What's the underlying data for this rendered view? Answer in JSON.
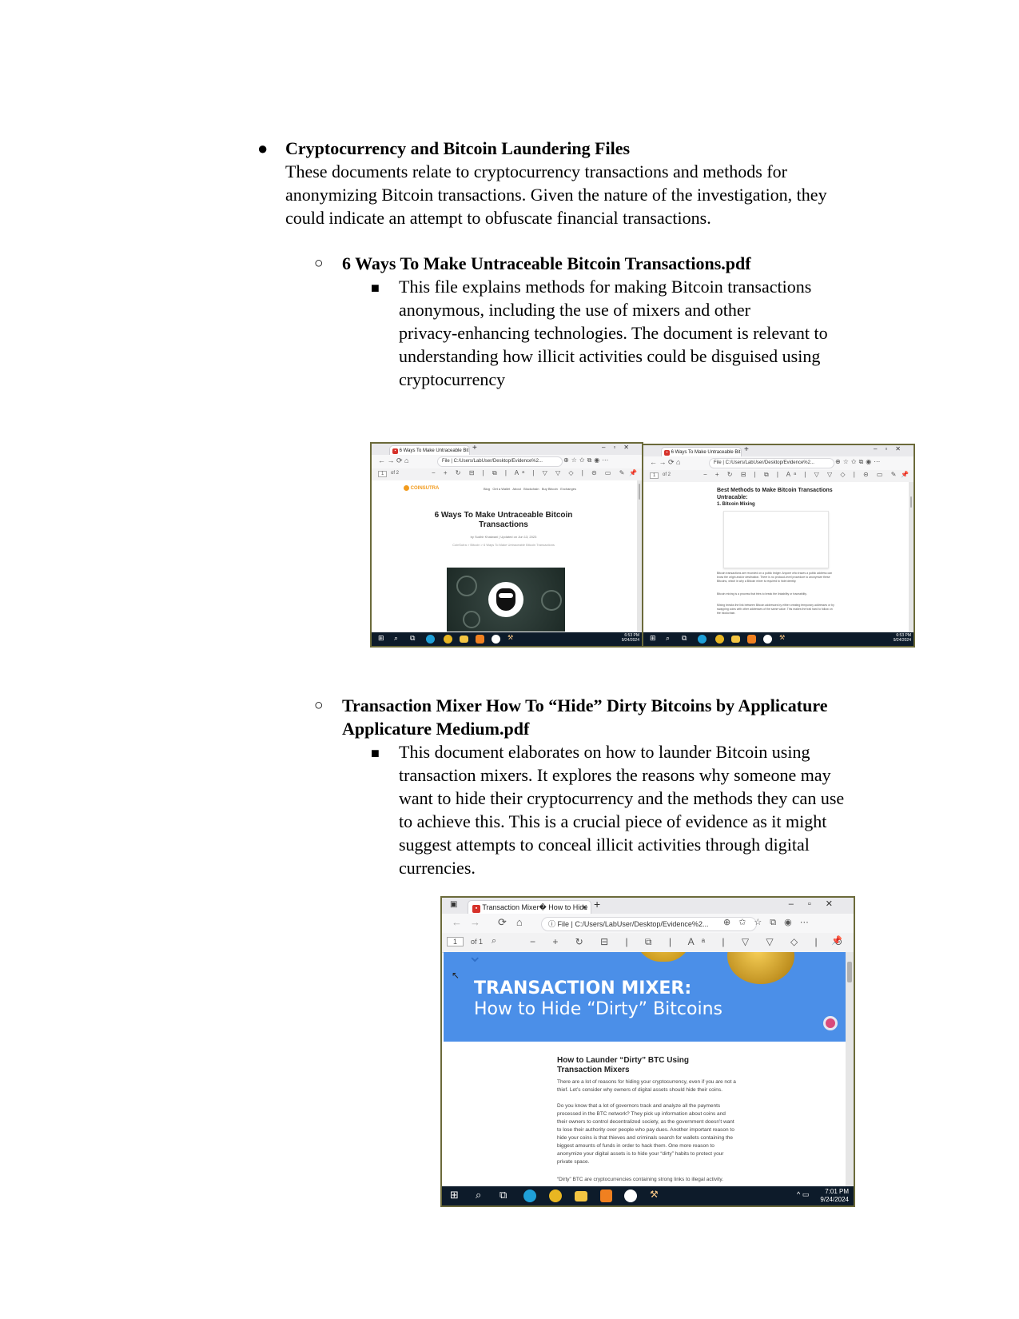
{
  "section": {
    "title": "Cryptocurrency and Bitcoin Laundering Files",
    "intro": [
      "These documents relate to cryptocurrency transactions and methods for",
      "anonymizing Bitcoin transactions. Given the nature of the investigation, they",
      "could indicate an attempt to obfuscate financial transactions."
    ],
    "bullet_glyph": "●",
    "sub_glyph": "○",
    "square_glyph": "■"
  },
  "file1": {
    "title": "6 Ways To Make Untraceable Bitcoin Transactions.pdf",
    "desc": [
      "This file explains methods for making Bitcoin transactions",
      "anonymous, including the use of mixers and other",
      "privacy-enhancing technologies. The document is relevant to",
      "understanding how illicit activities could be disguised using",
      "cryptocurrency"
    ]
  },
  "file2": {
    "title_lines": [
      "Transaction Mixer How To “Hide” Dirty Bitcoins by Applicature",
      "Applicature Medium.pdf"
    ],
    "desc": [
      "This document elaborates on how to launder Bitcoin using",
      "transaction mixers. It explores the reasons why someone may",
      "want to hide their cryptocurrency and the methods they can use",
      "to achieve this. This is a crucial piece of evidence as it might",
      "suggest attempts to conceal illicit activities through digital",
      "currencies."
    ]
  },
  "shot1": {
    "tab": "6 Ways To Make Untraceable Bit",
    "address": "C:/Users/LabUser/Desktop/Evidence%2...",
    "file_label": "File",
    "page_num": "1",
    "page_of": "of 2",
    "site_logo": "COINSUTRA",
    "site_nav": [
      "Blog",
      "Get a Wallet",
      "About",
      "Blockchain",
      "Buy Bitcoin",
      "Exchanges"
    ],
    "heading": "6 Ways To Make Untraceable Bitcoin Transactions",
    "byline": "by Sudhir Khatwani  |  Updated on Jun 13, 2023",
    "breadcrumb": "CoinSutra > Bitcoin > 6 Ways To Make Untraceable Bitcoin Transactions",
    "time": "6:53 PM",
    "date": "9/24/2024"
  },
  "shot2": {
    "tab": "6 Ways To Make Untraceable Bit",
    "address": "C:/Users/LabUser/Desktop/Evidence%2...",
    "file_label": "File",
    "page_num": "1",
    "page_of": "of 2",
    "heading": "Best Methods to Make Bitcoin Transactions Untracable:",
    "subheading": "1. Bitcoin Mixing",
    "para1": "Bitcoin transactions are recorded on a public ledger. Anyone who traces a public address can know the origin and/or destination. There is no protocol-level procedure to anonymize these Bitcoins, which is why a Bitcoin mixer is required to hide identity.",
    "para2": "Bitcoin mixing is a process that tries to break the linkability or traceability.",
    "para3": "Mixing breaks the link between Bitcoin addresses by either creating temporary addresses or by swapping coins with other addresses of the same value. This makes the trail hard to follow on the blockchain.",
    "time": "6:53 PM",
    "date": "9/24/2024"
  },
  "shot3": {
    "tab": "Transaction Mixer� How to Hide",
    "address": "C:/Users/LabUser/Desktop/Evidence%2...",
    "file_label": "File",
    "page_num": "1",
    "page_of": "of 1",
    "banner_title": "TRANSACTION MIXER:",
    "banner_sub": "How to Hide “Dirty” Bitcoins",
    "heading": "How to Launder “Dirty” BTC Using Transaction Mixers",
    "para1": "There are a lot of reasons for hiding your cryptocurrency, even if you are not a thief. Let’s consider why owners of digital assets should hide their coins.",
    "para2": "Do you know that a lot of governors track and analyze all the payments processed in the BTC network? They pick up information about coins and their owners to control decentralized society, as the government doesn’t want to lose their authority over people who pay dues. Another important reason to hide your coins is that thieves and criminals search for wallets containing the biggest amounts of funds in order to hack them. One more reason to anonymize your digital assets is to hide your “dirty” habits to protect your private space.",
    "para3": "“Dirty” BTC are cryptocurrencies containing strong links to illegal activity.",
    "time": "7:01 PM",
    "date": "9/24/2024"
  },
  "colors": {
    "window_border": "#6b6a3a",
    "banner_blue": "#4b8fe8",
    "taskbar": "#0d1b2a",
    "pdf_red": "#d6312a",
    "coinsutra_orange": "#f29b1d"
  }
}
